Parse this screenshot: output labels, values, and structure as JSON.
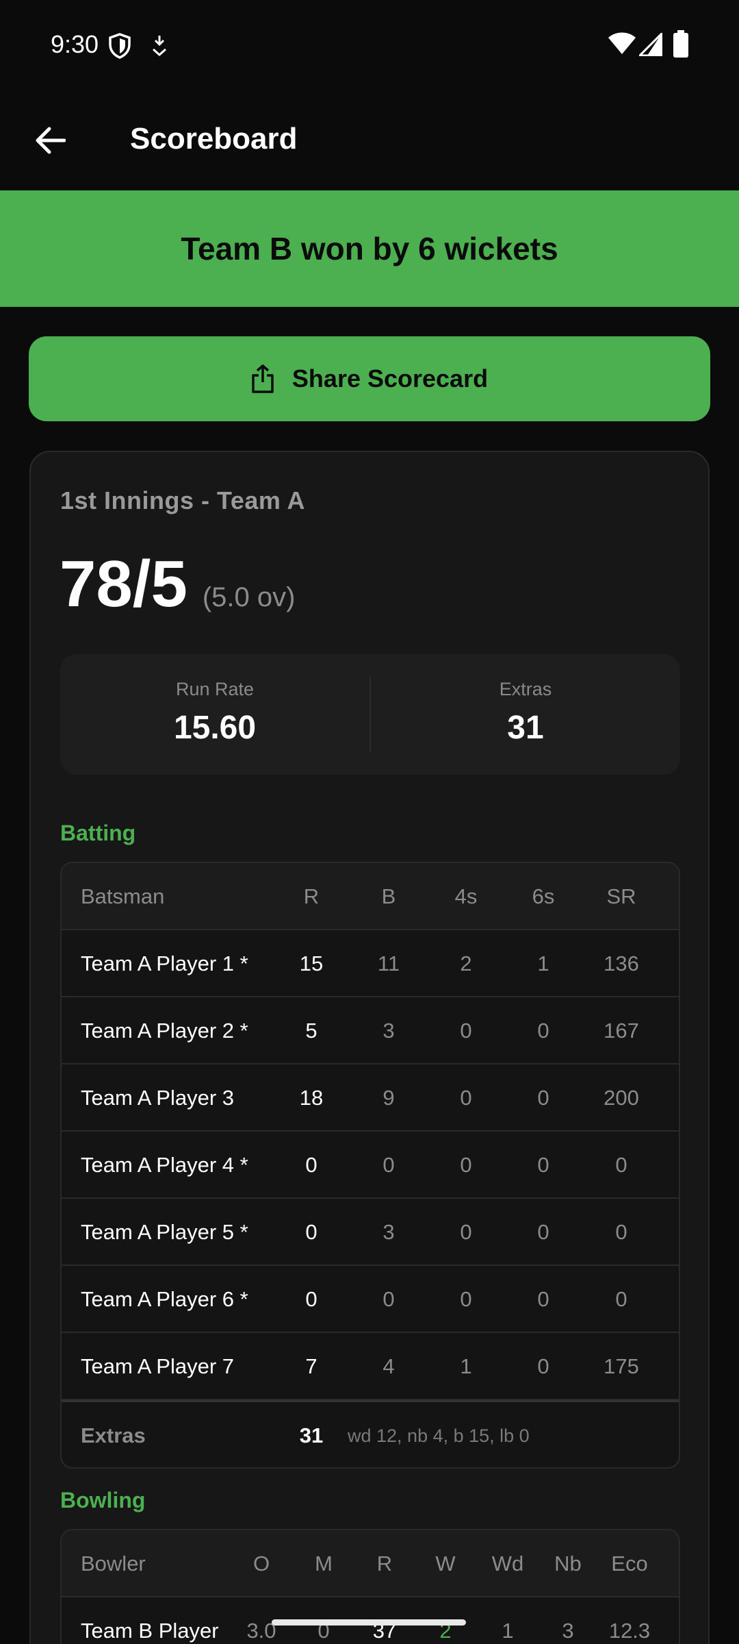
{
  "status": {
    "time": "9:30"
  },
  "app_bar": {
    "title": "Scoreboard"
  },
  "result": {
    "text": "Team B won by 6 wickets"
  },
  "share": {
    "label": "Share Scorecard"
  },
  "innings": {
    "title": "1st Innings - Team A",
    "score": "78/5",
    "overs": "(5.0 ov)",
    "run_rate_label": "Run Rate",
    "run_rate": "15.60",
    "extras_label": "Extras",
    "extras": "31"
  },
  "batting": {
    "label": "Batting",
    "headers": [
      "Batsman",
      "R",
      "B",
      "4s",
      "6s",
      "SR"
    ],
    "rows": [
      [
        "Team A Player 1 *",
        "15",
        "11",
        "2",
        "1",
        "136"
      ],
      [
        "Team A Player 2 *",
        "5",
        "3",
        "0",
        "0",
        "167"
      ],
      [
        "Team A Player 3",
        "18",
        "9",
        "0",
        "0",
        "200"
      ],
      [
        "Team A Player 4 *",
        "0",
        "0",
        "0",
        "0",
        "0"
      ],
      [
        "Team A Player 5 *",
        "0",
        "3",
        "0",
        "0",
        "0"
      ],
      [
        "Team A Player 6 *",
        "0",
        "0",
        "0",
        "0",
        "0"
      ],
      [
        "Team A Player 7",
        "7",
        "4",
        "1",
        "0",
        "175"
      ]
    ],
    "extras": {
      "label": "Extras",
      "value": "31",
      "detail": "wd 12, nb 4, b 15, lb 0"
    }
  },
  "bowling": {
    "label": "Bowling",
    "headers": [
      "Bowler",
      "O",
      "M",
      "R",
      "W",
      "Wd",
      "Nb",
      "Eco"
    ],
    "rows": [
      [
        "Team B Player",
        "3.0",
        "0",
        "37",
        "2",
        "1",
        "3",
        "12.3"
      ]
    ]
  },
  "colors": {
    "accent": "#4caf50",
    "background": "#0b0b0b",
    "card": "#171717"
  }
}
